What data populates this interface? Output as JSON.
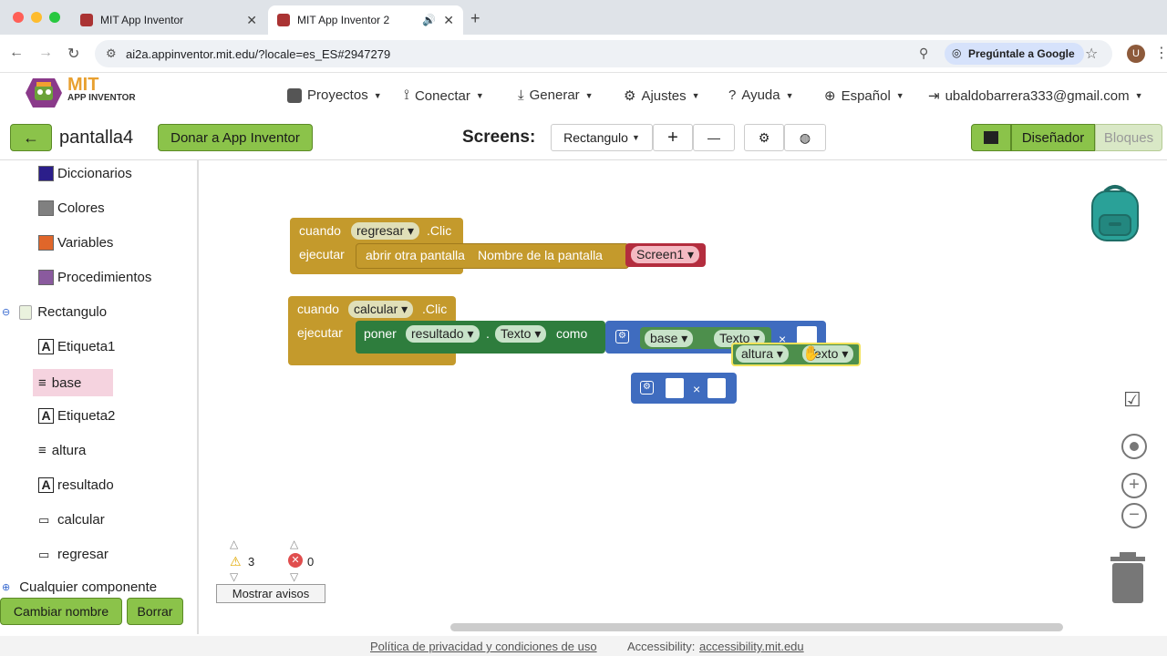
{
  "browser": {
    "tabs": [
      {
        "title": "MIT App Inventor",
        "active": false
      },
      {
        "title": "MIT App Inventor 2",
        "active": true
      }
    ],
    "url": "ai2a.appinventor.mit.edu/?locale=es_ES#2947279",
    "google_button": "Pregúntale a Google",
    "profile_initial": "U"
  },
  "app": {
    "logo_mit": "MIT",
    "logo_sub": "APP INVENTOR",
    "menus": [
      "Proyectos",
      "Conectar",
      "Generar",
      "Ajustes",
      "Ayuda",
      "Español",
      "ubaldobarrera333@gmail.com"
    ]
  },
  "toolbar": {
    "project_name": "pantalla4",
    "donate": "Donar a App Inventor",
    "screens_label": "Screens:",
    "screen_selected": "Rectangulo",
    "add": "+",
    "remove": "—",
    "designer": "Diseñador",
    "blocks": "Bloques"
  },
  "sidebar": {
    "builtins": [
      {
        "label": "Diccionarios",
        "color": "#2b1e8a"
      },
      {
        "label": "Colores",
        "color": "#808080"
      },
      {
        "label": "Variables",
        "color": "#e0662a"
      },
      {
        "label": "Procedimientos",
        "color": "#8a5a9e"
      }
    ],
    "screen": "Rectangulo",
    "components": [
      {
        "label": "Etiqueta1",
        "icon": "A"
      },
      {
        "label": "base",
        "icon": "≡"
      },
      {
        "label": "Etiqueta2",
        "icon": "A"
      },
      {
        "label": "altura",
        "icon": "≡"
      },
      {
        "label": "resultado",
        "icon": "A"
      },
      {
        "label": "calcular",
        "icon": "▭"
      },
      {
        "label": "regresar",
        "icon": "▭"
      }
    ],
    "any_component": "Cualquier componente",
    "rename": "Cambiar nombre",
    "delete": "Borrar"
  },
  "workspace": {
    "block1": {
      "when": "cuando",
      "component": "regresar",
      "event": ".Clic",
      "do": "ejecutar",
      "action": "abrir otra pantalla",
      "param": "Nombre de la pantalla",
      "value": "Screen1"
    },
    "block2": {
      "when": "cuando",
      "component": "calcular",
      "event": ".Clic",
      "do": "ejecutar",
      "set": "poner",
      "target": "resultado",
      "prop": "Texto",
      "as": "como"
    },
    "mult1": {
      "comp": "base",
      "prop": "Texto",
      "op": "×"
    },
    "drag": {
      "comp": "altura",
      "prop": "Texto"
    },
    "mult2": {
      "op": "×"
    },
    "warnings": "3",
    "errors": "0",
    "show_warnings": "Mostrar avisos"
  },
  "footer": {
    "privacy": "Política de privacidad y condiciones de uso",
    "accessibility_label": "Accessibility:",
    "accessibility_link": "accessibility.mit.edu"
  },
  "colors": {
    "green": "#8bc34a",
    "event": "#c49a2c",
    "set": "#2e7d3d",
    "math": "#3f6cbf",
    "text_block": "#4d8f4c"
  }
}
